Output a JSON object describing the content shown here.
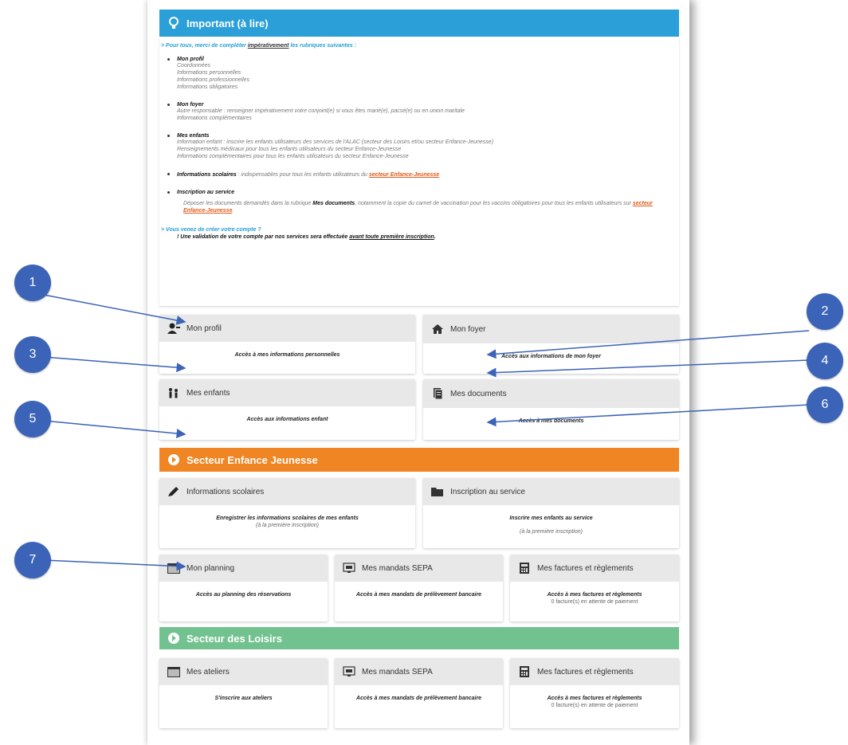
{
  "important_bar": {
    "title": "Important (à lire)"
  },
  "notice": {
    "lead_prefix": "> Pour tous, merci de compléter ",
    "lead_emph": "impérativement",
    "lead_suffix": " les rubriques suivantes :",
    "sections": [
      {
        "title": "Mon profil",
        "lines": [
          "Coordonnées",
          "Informations personnelles",
          "Informations professionnelles",
          "Informations obligatoires"
        ]
      },
      {
        "title": "Mon foyer",
        "lines": [
          "Autre responsable : renseigner impérativement votre conjoint(e) si vous êtes marié(e), pacsé(e) ou en union maritale",
          "Informations complémentaires"
        ]
      },
      {
        "title": "Mes enfants",
        "lines": [
          "Information enfant : inscrire les enfants utilisateurs des services de l'ALAC (secteur des Loisirs et/ou secteur Enfance-Jeunesse)",
          "Renseignements médicaux pour tous les enfants utilisateurs du secteur Enfance-Jeunesse",
          "Informations complémentaires pour tous les enfants utilisateurs du secteur Enfance-Jeunesse"
        ]
      },
      {
        "title": "Informations scolaires",
        "inline": " : indispensables pour tous les enfants utilisateurs du ",
        "inline_link": "secteur Enfance-Jeunesse",
        "lines": []
      },
      {
        "title": "Inscription au service",
        "lines": []
      }
    ],
    "inscription_text_a": "Déposer les documents demandés dans la rubrique ",
    "inscription_bold": "Mes documents",
    "inscription_text_b": ", notamment la copie du carnet de vaccination pour les vaccins obligatoires pour tous les enfants utilisateurs sur ",
    "inscription_link": "secteur Enfance-Jeunesse",
    "created_lead": "> Vous venez de créer votre compte ?",
    "created_note_a": "! Une validation de votre compte par nos services sera effectuée ",
    "created_note_link": "avant toute première inscription",
    "created_note_b": "."
  },
  "cards_top": [
    {
      "title": "Mon profil",
      "desc": "Accès à mes informations personnelles",
      "icon": "user-icon"
    },
    {
      "title": "Mon foyer",
      "desc": "Accès aux informations de mon foyer",
      "icon": "home-icon"
    },
    {
      "title": "Mes enfants",
      "desc": "Accès aux informations enfant",
      "icon": "children-icon"
    },
    {
      "title": "Mes documents",
      "desc": "Accès à mes documents",
      "icon": "documents-icon"
    }
  ],
  "enfance_bar": {
    "title": "Secteur Enfance Jeunesse",
    "color": "#ef8523"
  },
  "cards_enfance": [
    {
      "title": "Informations scolaires",
      "desc": "Enregistrer les informations scolaires de mes enfants",
      "sub": "(à la première inscription)",
      "icon": "pencil-icon"
    },
    {
      "title": "Inscription au service",
      "desc": "Inscrire mes enfants au service",
      "sub": "(à la première inscription)",
      "icon": "folder-icon"
    },
    {
      "title": "Mon planning",
      "desc": "Accès au planning des réservations",
      "icon": "calendar-icon"
    },
    {
      "title": "Mes mandats SEPA",
      "desc": "Accès à mes mandats de prélèvement bancaire",
      "icon": "sepa-icon"
    },
    {
      "title": "Mes factures et règlements",
      "desc": "Accès à mes factures et règlements",
      "sub": "0 facture(s) en attente de paiement",
      "icon": "calculator-icon"
    }
  ],
  "loisirs_bar": {
    "title": "Secteur des Loisirs",
    "color": "#72c28f"
  },
  "cards_loisirs": [
    {
      "title": "Mes ateliers",
      "desc": "S'inscrire aux ateliers",
      "icon": "calendar-icon"
    },
    {
      "title": "Mes mandats SEPA",
      "desc": "Accès à mes mandats de prélèvement bancaire",
      "icon": "sepa-icon"
    },
    {
      "title": "Mes factures et règlements",
      "desc": "Accès à mes factures et règlements",
      "sub": "0 facture(s) en attente de paiement",
      "icon": "calculator-icon"
    }
  ],
  "badges": [
    "1",
    "2",
    "3",
    "4",
    "5",
    "6",
    "7"
  ],
  "accent_colors": {
    "blue": "#2a9fd8",
    "orange": "#ef8523",
    "green": "#72c28f",
    "badge": "#3b63b8"
  }
}
